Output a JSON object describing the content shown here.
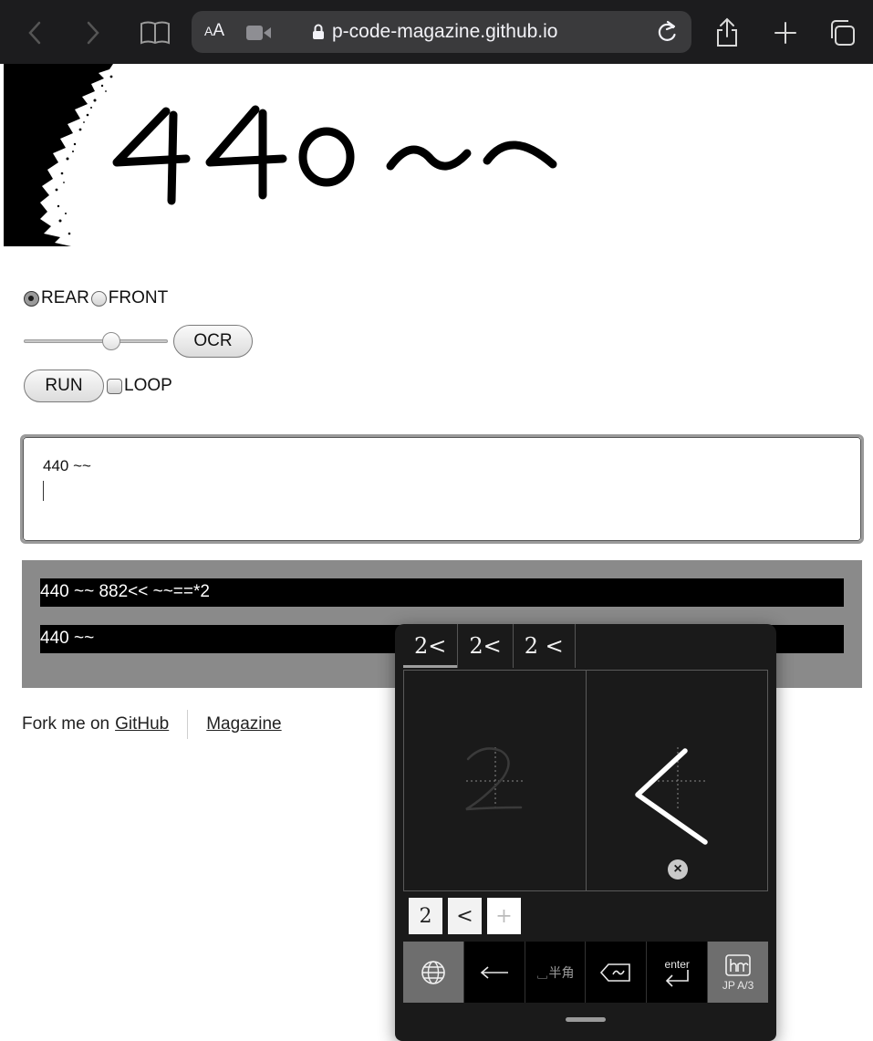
{
  "browser": {
    "text_size_label": "AA",
    "url_host": "p-code-magazine.github.io"
  },
  "capture": {
    "handwritten_text": "440~~"
  },
  "controls": {
    "camera_options": [
      {
        "label": "REAR",
        "checked": true
      },
      {
        "label": "FRONT",
        "checked": false
      }
    ],
    "slider_fraction": 0.62,
    "ocr_label": "OCR",
    "run_label": "RUN",
    "loop_label": "LOOP",
    "loop_checked": false
  },
  "textarea": {
    "value": "440 ~~"
  },
  "results": {
    "lines": [
      "440 ~~ 882<< ~~==*2",
      "440 ~~"
    ]
  },
  "footer": {
    "fork_text": "Fork me on",
    "github_link": "GitHub",
    "magazine_link": "Magazine"
  },
  "ime": {
    "candidates": [
      "2<",
      "2<",
      "2 <"
    ],
    "chips": [
      "2",
      "<",
      "+"
    ],
    "keys": {
      "space_label": "␣半角",
      "enter_label": "enter",
      "mode_label": "JP A/3"
    }
  },
  "colors": {
    "toolbar_bg": "#1c1c1e",
    "urlbar_bg": "#3a3a3c",
    "results_bg": "#8a8a8a",
    "ime_bg": "#1a1a1a"
  }
}
